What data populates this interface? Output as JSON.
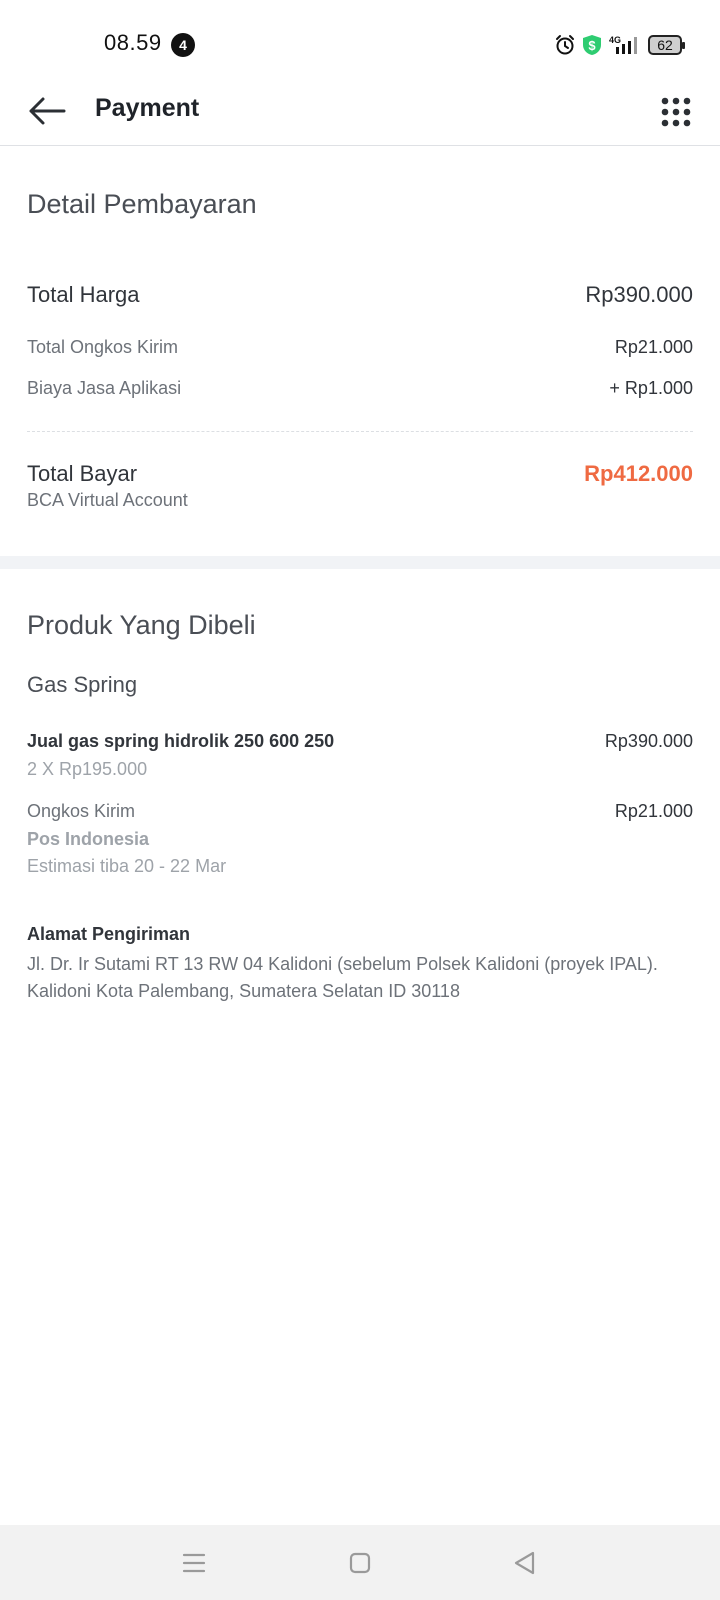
{
  "status_bar": {
    "time": "08.59",
    "notification_count": "4",
    "battery": "62",
    "network": "4G",
    "icons": [
      "alarm-icon",
      "dollar-shield-icon",
      "signal-icon",
      "battery-icon"
    ]
  },
  "header": {
    "title": "Payment",
    "back_icon": "arrow-left-icon",
    "menu_icon": "grid-dots-icon"
  },
  "payment_detail": {
    "section_title": "Detail Pembayaran",
    "total_price_label": "Total Harga",
    "total_price_value": "Rp390.000",
    "shipping_label": "Total Ongkos Kirim",
    "shipping_value": "Rp21.000",
    "app_fee_label": "Biaya Jasa Aplikasi",
    "app_fee_value": "+ Rp1.000",
    "total_pay_label": "Total Bayar",
    "total_pay_value": "Rp412.000",
    "payment_method": "BCA Virtual Account"
  },
  "products": {
    "section_title": "Produk Yang Dibeli",
    "group_name": "Gas Spring",
    "item_name": "Jual gas spring hidrolik 250 600 250",
    "item_qty": "2 X Rp195.000",
    "item_price": "Rp390.000",
    "shipping_label": "Ongkos Kirim",
    "courier": "Pos Indonesia",
    "eta": "Estimasi tiba 20 - 22 Mar",
    "shipping_price": "Rp21.000"
  },
  "address": {
    "title": "Alamat Pengiriman",
    "text": "Jl. Dr. Ir Sutami RT 13 RW 04 Kalidoni (sebelum Polsek Kalidoni (proyek IPAL). Kalidoni Kota Palembang, Sumatera Selatan ID 30118"
  },
  "colors": {
    "accent_total": "#ef6a42",
    "text_primary": "#31353b",
    "text_secondary": "#6d7279",
    "section_gap": "#f1f3f6"
  },
  "nav_bar": {
    "icons": [
      "menu-lines-icon",
      "home-square-icon",
      "back-triangle-icon"
    ]
  }
}
